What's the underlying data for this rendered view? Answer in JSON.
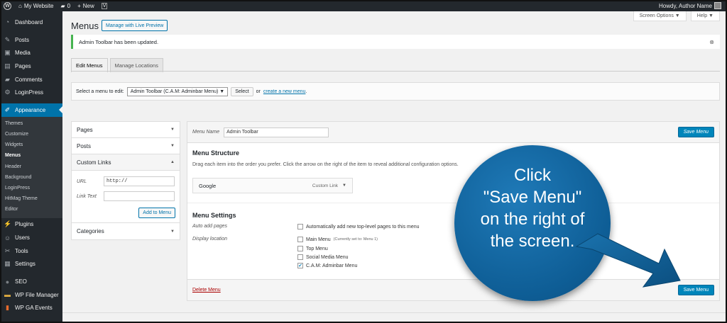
{
  "adminbar": {
    "site": "My Website",
    "comments": "0",
    "new": "New",
    "greeting": "Howdy, Author Name"
  },
  "sidebar": {
    "items": [
      {
        "label": "Dashboard",
        "icon": "dashboard-icon"
      },
      {
        "label": "Posts",
        "icon": "pin-icon"
      },
      {
        "label": "Media",
        "icon": "media-icon"
      },
      {
        "label": "Pages",
        "icon": "page-icon"
      },
      {
        "label": "Comments",
        "icon": "comment-icon"
      },
      {
        "label": "LoginPress",
        "icon": "gear-icon"
      },
      {
        "label": "Appearance",
        "icon": "brush-icon"
      }
    ],
    "submenu": [
      "Themes",
      "Customize",
      "Widgets",
      "Menus",
      "Header",
      "Background",
      "LoginPress",
      "HitMag Theme",
      "Editor"
    ],
    "items_after": [
      {
        "label": "Plugins",
        "icon": "plug-icon"
      },
      {
        "label": "Users",
        "icon": "user-icon"
      },
      {
        "label": "Tools",
        "icon": "wrench-icon"
      },
      {
        "label": "Settings",
        "icon": "settings-icon"
      },
      {
        "label": "SEO",
        "icon": "seo-icon"
      },
      {
        "label": "WP File Manager",
        "icon": "folder-icon"
      },
      {
        "label": "WP GA Events",
        "icon": "events-icon"
      }
    ]
  },
  "header": {
    "screen_options": "Screen Options ▼",
    "help": "Help ▼",
    "title": "Menus",
    "live_preview": "Manage with Live Preview"
  },
  "notice": {
    "text": "Admin Toolbar has been updated."
  },
  "tabs": {
    "edit": "Edit Menus",
    "locations": "Manage Locations"
  },
  "select_menu": {
    "label": "Select a menu to edit:",
    "value": "Admin Toolbar (C.A.M: Adminbar Menu) ▼",
    "button": "Select",
    "or": "or",
    "create_link": "create a new menu",
    "period": "."
  },
  "accordion": {
    "pages": "Pages",
    "posts": "Posts",
    "custom_links": "Custom Links",
    "url_label": "URL",
    "url_value": "http://",
    "link_text_label": "Link Text",
    "add_button": "Add to Menu",
    "categories": "Categories"
  },
  "menu_panel": {
    "menu_name_label": "Menu Name",
    "menu_name_value": "Admin Toolbar",
    "save_label": "Save Menu",
    "structure_title": "Menu Structure",
    "structure_desc": "Drag each item into the order you prefer. Click the arrow on the right of the item to reveal additional configuration options.",
    "item_title": "Google",
    "item_type": "Custom Link",
    "settings_title": "Menu Settings",
    "auto_add_label": "Auto add pages",
    "auto_add_option": "Automatically add new top-level pages to this menu",
    "display_location_label": "Display location",
    "locations": [
      {
        "label": "Main Menu",
        "note": "(Currently set to: Menu 1)",
        "checked": false
      },
      {
        "label": "Top Menu",
        "note": "",
        "checked": false
      },
      {
        "label": "Social Media Menu",
        "note": "",
        "checked": false
      },
      {
        "label": "C.A.M: Adminbar Menu",
        "note": "",
        "checked": true
      }
    ],
    "delete_label": "Delete Menu"
  },
  "callout": {
    "lines": [
      "Click",
      "\"Save Menu\"",
      "on the right of",
      "the screen."
    ],
    "color": "#0e5d95"
  }
}
